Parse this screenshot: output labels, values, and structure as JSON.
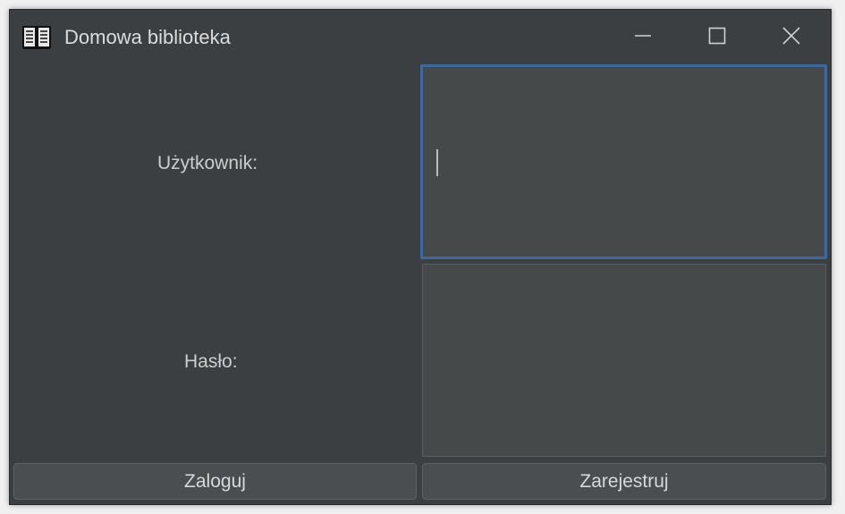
{
  "window": {
    "title": "Domowa biblioteka",
    "app_icon": "book-icon",
    "controls": {
      "minimize_icon": "minimize-icon",
      "maximize_icon": "maximize-icon",
      "close_icon": "close-icon"
    }
  },
  "form": {
    "username_label": "Użytkownik:",
    "username_value": "",
    "password_label": "Hasło:",
    "password_value": ""
  },
  "buttons": {
    "login_label": "Zaloguj",
    "register_label": "Zarejestruj"
  },
  "colors": {
    "background": "#3c3f41",
    "field_background": "#45494a",
    "focus_border": "#3d6a9e",
    "text": "#cdcdcd"
  }
}
